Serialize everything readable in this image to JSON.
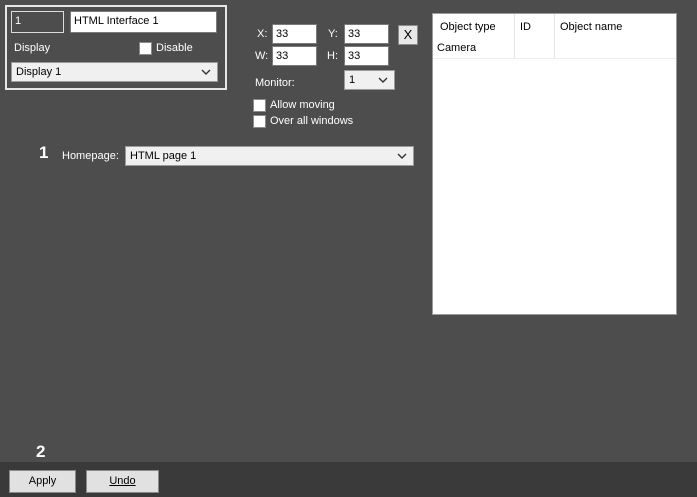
{
  "display_group": {
    "id_value": "1",
    "name_value": "HTML Interface 1",
    "display_label": "Display",
    "disable_label": "Disable",
    "display_select": "Display 1"
  },
  "position": {
    "x_label": "X:",
    "x_value": "33",
    "y_label": "Y:",
    "y_value": "33",
    "w_label": "W:",
    "w_value": "33",
    "h_label": "H:",
    "h_value": "33",
    "close_label": "X",
    "monitor_label": "Monitor:",
    "monitor_value": "1",
    "allow_moving_label": "Allow moving",
    "over_all_windows_label": "Over all windows"
  },
  "homepage": {
    "callout": "1",
    "label": "Homepage:",
    "value": "HTML page 1"
  },
  "object_table": {
    "columns": [
      "Object type",
      "ID",
      "Object name"
    ],
    "rows": [
      [
        "Camera",
        "",
        ""
      ]
    ]
  },
  "footer": {
    "callout": "2",
    "apply_label": "Apply",
    "undo_label": "Undo"
  }
}
